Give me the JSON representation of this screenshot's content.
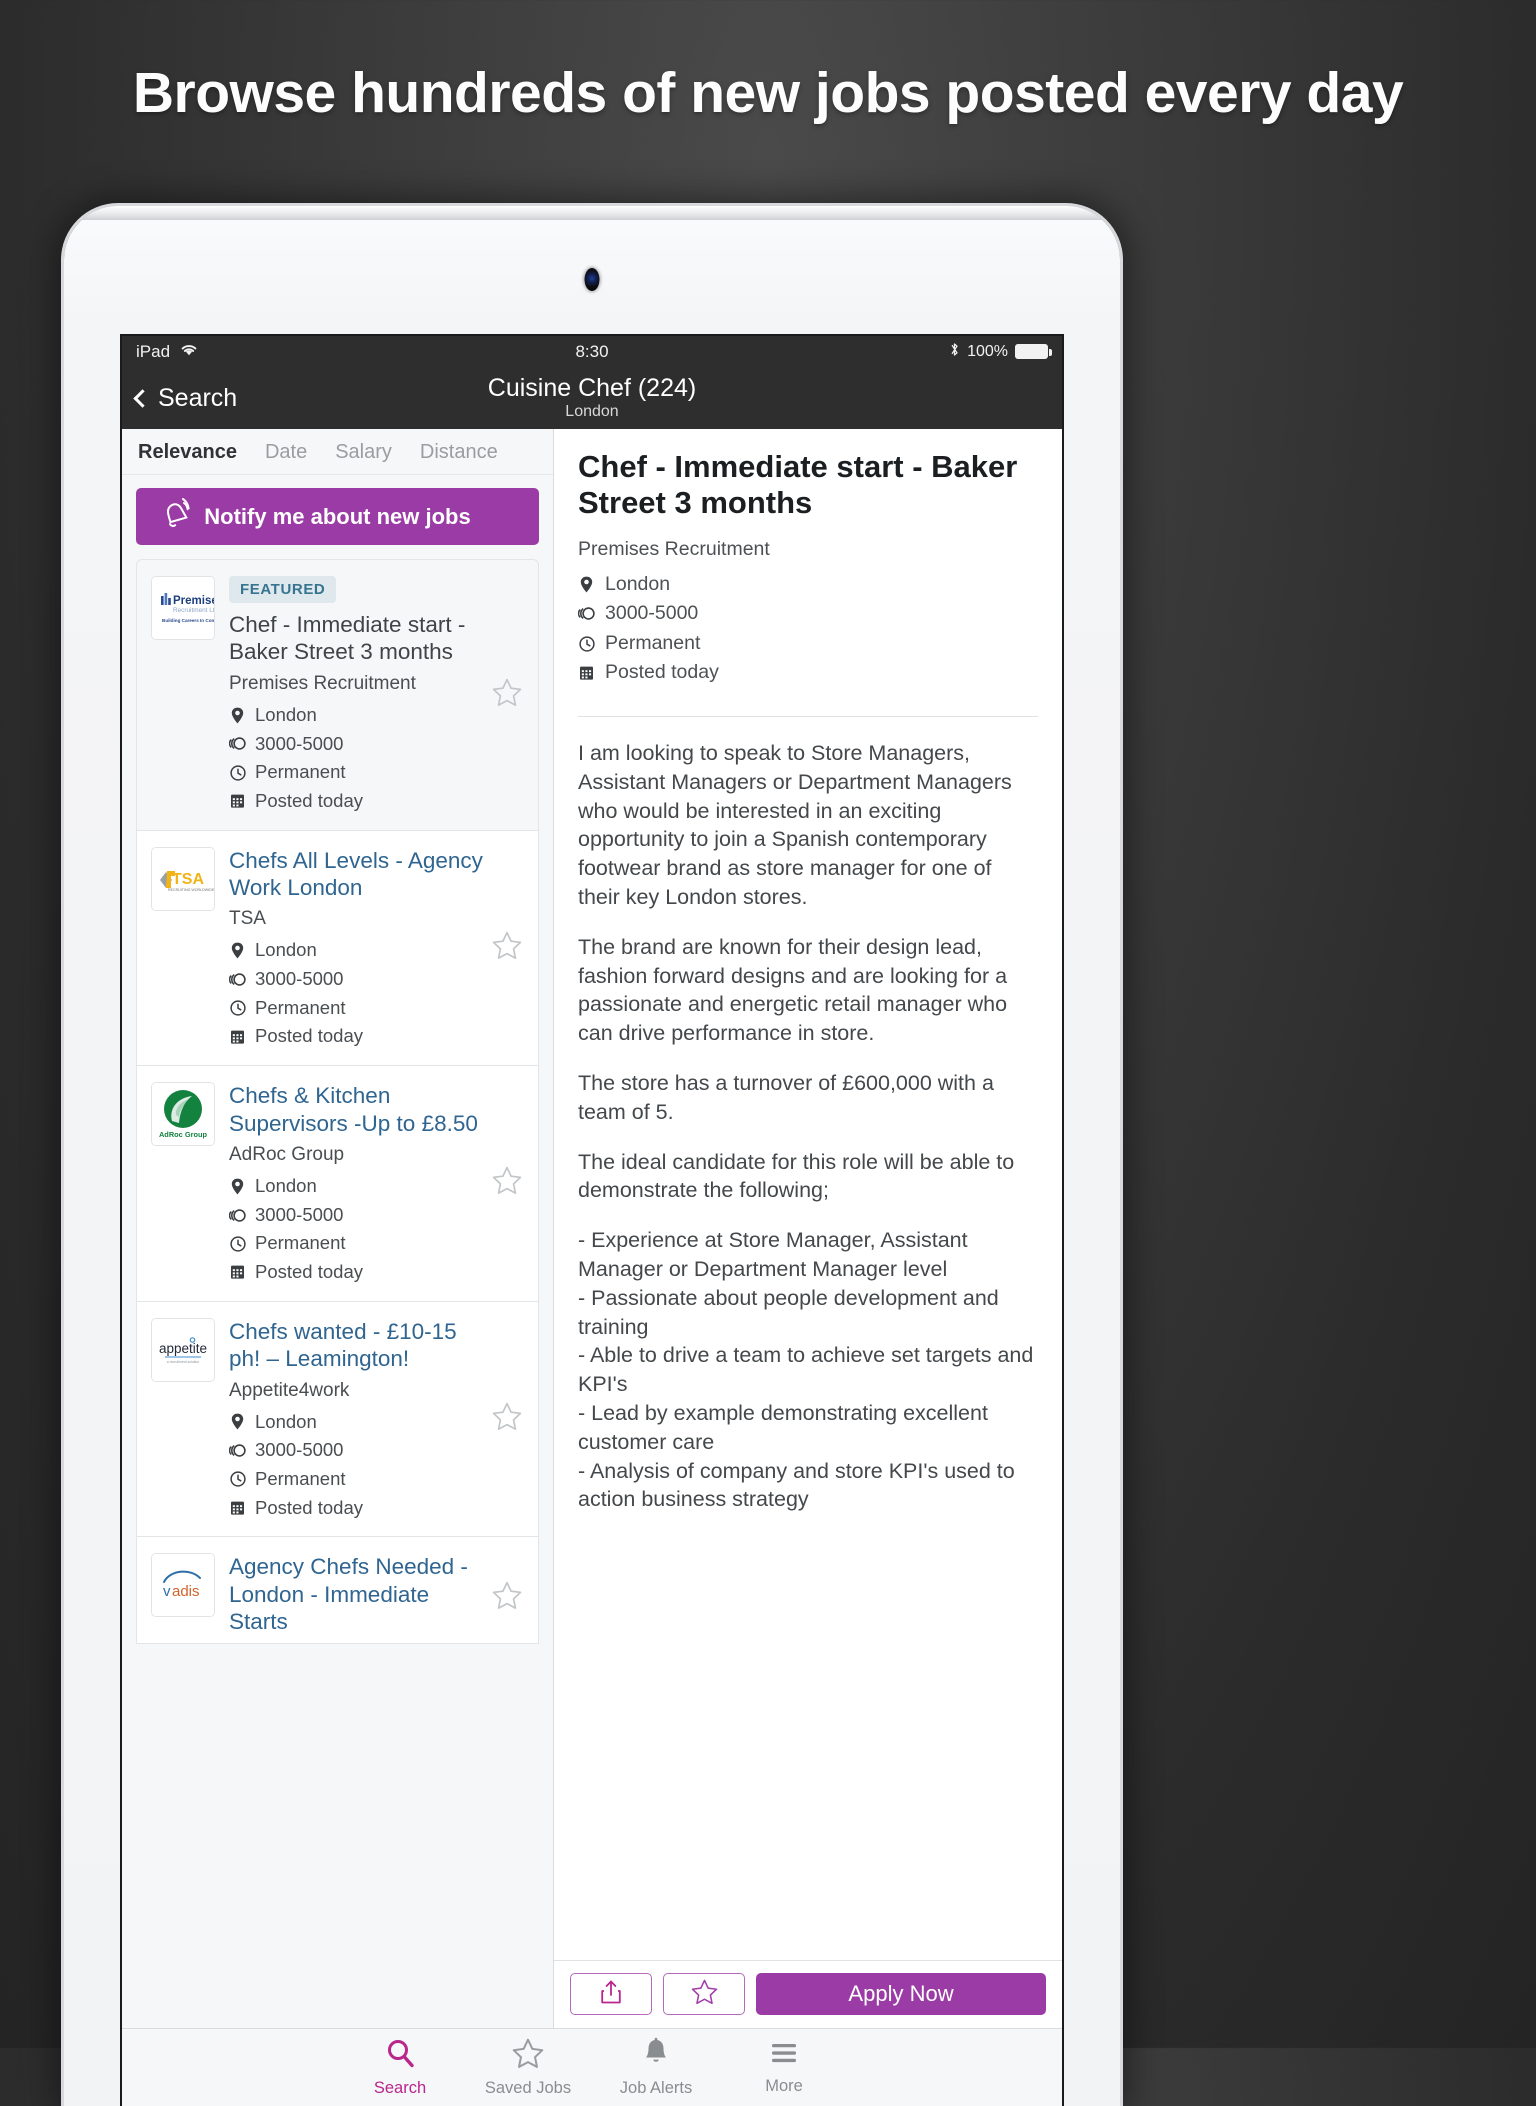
{
  "headline": "Browse hundreds of new jobs posted every day",
  "status_bar": {
    "device": "iPad",
    "wifi_icon": "wifi-icon",
    "time": "8:30",
    "bluetooth_icon": "bluetooth-icon",
    "battery_percent": "100%"
  },
  "nav_bar": {
    "back_label": "Search",
    "title": "Cuisine Chef (224)",
    "subtitle": "London"
  },
  "filters": [
    {
      "label": "Relevance",
      "active": true
    },
    {
      "label": "Date",
      "active": false
    },
    {
      "label": "Salary",
      "active": false
    },
    {
      "label": "Distance",
      "active": false
    }
  ],
  "notify": {
    "label": "Notify me about new jobs",
    "icon": "bell-ring-icon",
    "color": "#9b3ba5"
  },
  "jobs": [
    {
      "badge": "FEATURED",
      "title": "Chef - Immediate start - Baker Street 3 months",
      "company": "Premises Recruitment",
      "location": "London",
      "salary": "3000-5000",
      "type": "Permanent",
      "posted": "Posted today",
      "logo_text": "Premises",
      "logo_sub": "Recruitment Ltd",
      "logo_tag": "Building Careers In Construction",
      "featured": true
    },
    {
      "badge": "",
      "title": "Chefs All Levels - Agency Work London",
      "company": "TSA",
      "location": "London",
      "salary": "3000-5000",
      "type": "Permanent",
      "posted": "Posted today",
      "logo_text": "TSA",
      "logo_sub": "RECRUITING WORLDWIDE",
      "logo_tag": "",
      "featured": false
    },
    {
      "badge": "",
      "title": "Chefs & Kitchen Supervisors -Up to £8.50",
      "company": "AdRoc Group",
      "location": "London",
      "salary": "3000-5000",
      "type": "Permanent",
      "posted": "Posted today",
      "logo_text": "",
      "logo_sub": "AdRoc Group",
      "logo_tag": "",
      "featured": false
    },
    {
      "badge": "",
      "title": "Chefs wanted - £10-15 ph! – Leamington!",
      "company": "Appetite4work",
      "location": "London",
      "salary": "3000-5000",
      "type": "Permanent",
      "posted": "Posted today",
      "logo_text": "appetite",
      "logo_sub": "",
      "logo_tag": "",
      "featured": false
    },
    {
      "badge": "",
      "title": "Agency Chefs Needed - London - Immediate Starts",
      "company": "",
      "location": "",
      "salary": "",
      "type": "",
      "posted": "",
      "logo_text": "vadis",
      "logo_sub": "",
      "logo_tag": "",
      "featured": false
    }
  ],
  "detail": {
    "title": "Chef - Immediate start - Baker Street 3 months",
    "company": "Premises Recruitment",
    "location": "London",
    "salary": "3000-5000",
    "type": "Permanent",
    "posted": "Posted today",
    "paragraphs": [
      "I am looking to speak to Store Managers, Assistant Managers or Department Managers who would be interested in an exciting opportunity to join a Spanish contemporary footwear brand as store manager for one of their key London stores.",
      "The brand are known for their design lead, fashion forward designs and are looking for a passionate and energetic retail manager who can drive performance in store.",
      "The store has a turnover of £600,000 with a team of 5.",
      "The ideal candidate for this role will be able to demonstrate the following;",
      "- Experience at Store Manager, Assistant Manager or Department Manager level\n- Passionate about people development and training\n- Able to drive a team to achieve set targets and KPI's\n- Lead by example demonstrating excellent customer care\n- Analysis of company and store KPI's used to action business strategy"
    ],
    "actions": {
      "share_icon": "share-icon",
      "save_icon": "star-icon",
      "apply_label": "Apply Now",
      "apply_color": "#9b3ba5"
    }
  },
  "tabbar": [
    {
      "label": "Search",
      "icon": "search-icon",
      "active": true
    },
    {
      "label": "Saved Jobs",
      "icon": "star-icon",
      "active": false
    },
    {
      "label": "Job Alerts",
      "icon": "bell-icon",
      "active": false
    },
    {
      "label": "More",
      "icon": "hamburger-icon",
      "active": false
    }
  ],
  "colors": {
    "accent_purple": "#9b3ba5",
    "accent_pink": "#b9268c",
    "link_blue": "#2f6590",
    "badge_bg": "#dfe8ec",
    "badge_text": "#36748f"
  }
}
